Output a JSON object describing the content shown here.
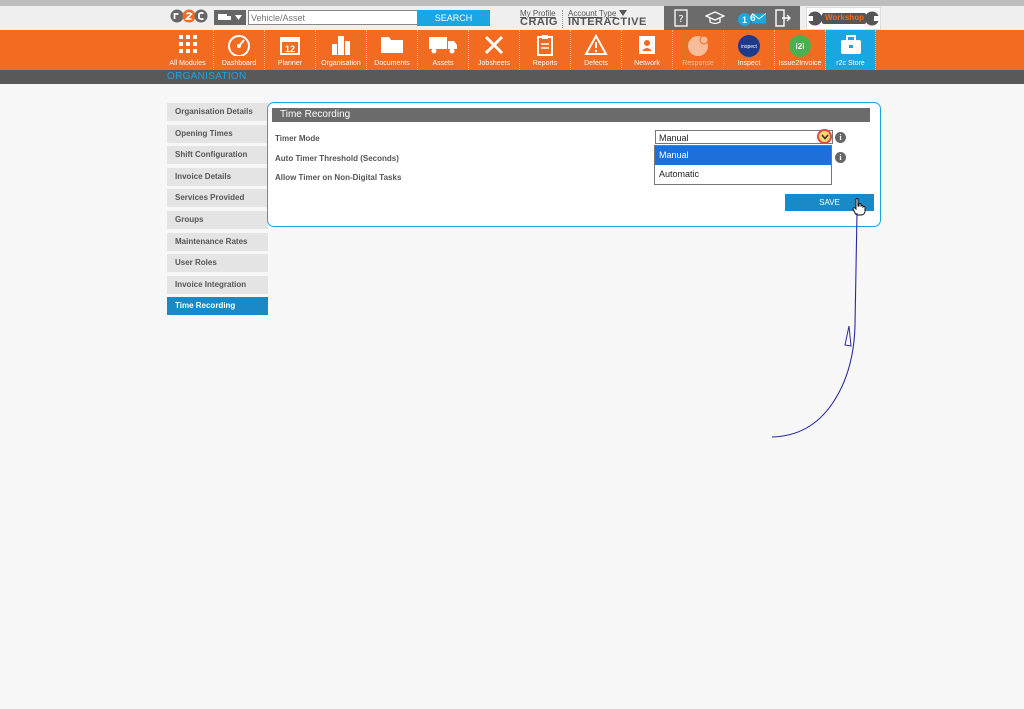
{
  "header": {
    "search_placeholder": "Vehicle/Asset",
    "search_button": "SEARCH",
    "profile_link": "My Profile",
    "profile_name": "CRAIG",
    "account_type_link": "Account Type",
    "account_type_value": "INTERACTIVE",
    "notification_count": "1",
    "message_count": "6",
    "workshop_label": "Workshop"
  },
  "nav": [
    {
      "label": "All Modules"
    },
    {
      "label": "Dashboard"
    },
    {
      "label": "Planner"
    },
    {
      "label": "Organisation"
    },
    {
      "label": "Documents"
    },
    {
      "label": "Assets"
    },
    {
      "label": "Jobsheets"
    },
    {
      "label": "Reports"
    },
    {
      "label": "Defects"
    },
    {
      "label": "Network"
    },
    {
      "label": "Response"
    },
    {
      "label": "Inspect"
    },
    {
      "label": "Issue2Invoice"
    },
    {
      "label": "r2c Store"
    }
  ],
  "planner_day": "12",
  "inspect_icon_text": "inspect",
  "i2i_icon_text": "i2i",
  "section_title": "ORGANISATION",
  "sidebar": {
    "items": [
      {
        "label": "Organisation Details"
      },
      {
        "label": "Opening Times"
      },
      {
        "label": "Shift Configuration"
      },
      {
        "label": "Invoice Details"
      },
      {
        "label": "Services Provided"
      },
      {
        "label": "Groups"
      },
      {
        "label": "Maintenance Rates"
      },
      {
        "label": "User Roles"
      },
      {
        "label": "Invoice Integration"
      },
      {
        "label": "Time Recording"
      }
    ]
  },
  "panel": {
    "title": "Time Recording",
    "fields": {
      "timer_mode_label": "Timer Mode",
      "auto_threshold_label": "Auto Timer Threshold (Seconds)",
      "allow_timer_label": "Allow Timer on Non-Digital Tasks"
    },
    "timer_mode_value": "Manual",
    "dropdown_options": [
      "Manual",
      "Automatic"
    ],
    "save_label": "SAVE"
  },
  "colors": {
    "brand_orange": "#f26b21",
    "accent_blue": "#1aa6e0",
    "active_blue": "#1a8ac7",
    "selected_option": "#1e6fd9",
    "annotation_ink": "#2a2aa0"
  }
}
